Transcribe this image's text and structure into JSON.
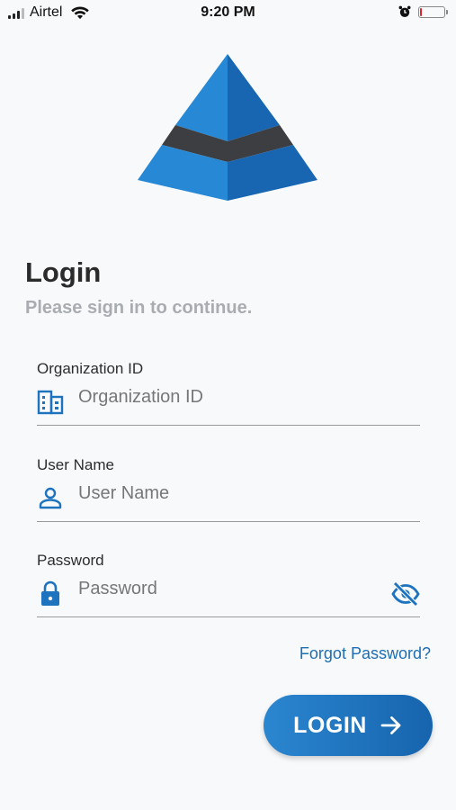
{
  "status_bar": {
    "carrier": "Airtel",
    "time": "9:20 PM",
    "battery_level": 0.08,
    "battery_color": "#e5202a"
  },
  "logo": {
    "icon": "pyramid-logo",
    "colors": [
      "#1e73be",
      "#3b3d40"
    ]
  },
  "header": {
    "title": "Login",
    "subtitle": "Please sign in to continue."
  },
  "form": {
    "organization": {
      "label": "Organization ID",
      "placeholder": "Organization ID",
      "value": "",
      "icon": "building-icon"
    },
    "username": {
      "label": "User Name",
      "placeholder": "User Name",
      "value": "",
      "icon": "person-icon"
    },
    "password": {
      "label": "Password",
      "placeholder": "Password",
      "value": "",
      "icon": "lock-icon",
      "toggle_icon": "eye-off-icon"
    }
  },
  "forgot_password": "Forgot Password?",
  "login_button": {
    "label": "LOGIN",
    "icon": "arrow-right-icon"
  },
  "colors": {
    "accent": "#1e73be",
    "link": "#1e6eb3",
    "background": "#f7f9fb"
  }
}
